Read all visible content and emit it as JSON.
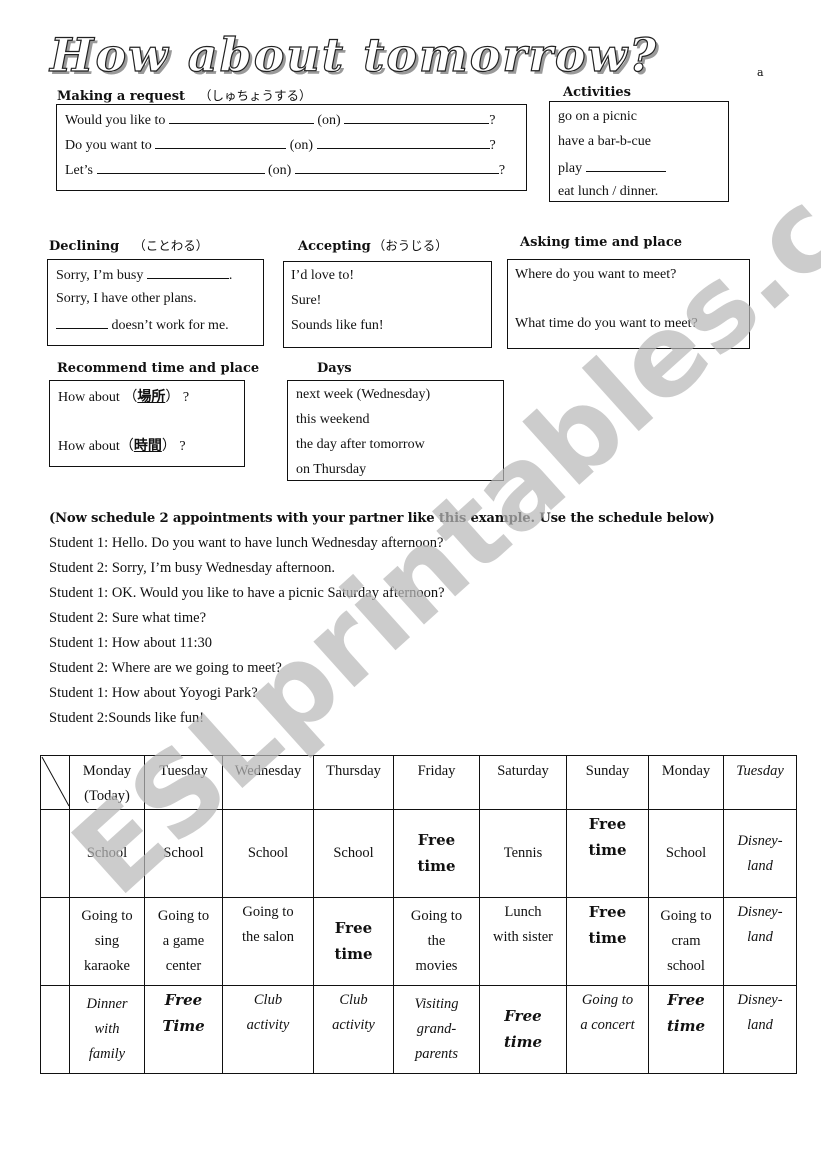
{
  "title": "How about tomorrow?",
  "title_mark": "a",
  "watermark": "ESLprintables.com",
  "sections": {
    "making_request": {
      "heading": "Making a request",
      "heading_jp": "（しゅちょうする）",
      "lines": [
        {
          "start": "Would you like to",
          "mid": "(on)",
          "end": "?"
        },
        {
          "start": "Do you want to",
          "mid": "(on)",
          "end": "?"
        },
        {
          "start": "Let’s",
          "mid": "(on)",
          "end": "?"
        }
      ]
    },
    "activities": {
      "heading": "Activities",
      "items": [
        "go on a picnic",
        "have a bar-b-cue",
        "play",
        "eat lunch / dinner."
      ]
    },
    "declining": {
      "heading": "Declining",
      "heading_jp": "（ことわる）",
      "items": [
        {
          "before": "Sorry, I’m busy",
          "after": "."
        },
        {
          "text": "Sorry, I have other plans."
        },
        {
          "before": "",
          "after": "doesn’t work for me."
        }
      ]
    },
    "accepting": {
      "heading": "Accepting",
      "heading_jp": "（おうじる）",
      "items": [
        "I’d love to!",
        "Sure!",
        "Sounds like fun!"
      ]
    },
    "asking": {
      "heading": "Asking time and place",
      "items": [
        "Where do you want to meet?",
        "What time do you want to meet?"
      ]
    },
    "recommend": {
      "heading": "Recommend time and place",
      "items": [
        {
          "text": "How about",
          "jp": "場所",
          "end": "?"
        },
        {
          "text": "How about",
          "jp": "時間",
          "end": "?"
        }
      ]
    },
    "days": {
      "heading": "Days",
      "items": [
        "next week (Wednesday)",
        "this weekend",
        "the day after tomorrow",
        "on Thursday"
      ]
    }
  },
  "instructions": "(Now schedule 2 appointments with your partner like this example. Use the schedule below)",
  "dialog": [
    "Student 1: Hello.    Do you want to have lunch Wednesday afternoon?",
    "Student 2: Sorry, I’m busy Wednesday afternoon.",
    "Student 1: OK.    Would you like to have a picnic Saturday afternoon?",
    "Student 2: Sure what time?",
    "Student 1: How about 11:30",
    "Student 2: Where are we going to meet?",
    "Student 1: How about Yoyogi Park?",
    "Student 2:Sounds like fun!"
  ],
  "schedule": {
    "days": [
      {
        "label": "Monday\n(Today)",
        "style": "normal"
      },
      {
        "label": "Tuesday",
        "style": "normal"
      },
      {
        "label": "Wednesday",
        "style": "normal"
      },
      {
        "label": "Thursday",
        "style": "normal"
      },
      {
        "label": "Friday",
        "style": "normal"
      },
      {
        "label": "Saturday",
        "style": "normal"
      },
      {
        "label": "Sunday",
        "style": "normal"
      },
      {
        "label": "Monday",
        "style": "normal"
      },
      {
        "label": "Tuesday",
        "style": "italic"
      }
    ],
    "rows": [
      [
        {
          "text": "School",
          "style": "normal"
        },
        {
          "text": "School",
          "style": "normal"
        },
        {
          "text": "School",
          "style": "normal"
        },
        {
          "text": "School",
          "style": "normal"
        },
        {
          "text": "Free\ntime",
          "style": "free"
        },
        {
          "text": "Tennis",
          "style": "normal"
        },
        {
          "text": "Free\ntime",
          "style": "free-top"
        },
        {
          "text": "School",
          "style": "normal"
        },
        {
          "text": "Disney-\nland",
          "style": "italic"
        }
      ],
      [
        {
          "text": "Going to\nsing\nkaraoke",
          "style": "normal"
        },
        {
          "text": "Going to\na game\ncenter",
          "style": "normal"
        },
        {
          "text": "Going to\nthe salon",
          "style": "normal-top"
        },
        {
          "text": "Free\ntime",
          "style": "free"
        },
        {
          "text": "Going to\nthe\nmovies",
          "style": "normal"
        },
        {
          "text": "Lunch\nwith sister",
          "style": "normal-top"
        },
        {
          "text": "Free\ntime",
          "style": "free-top"
        },
        {
          "text": "Going to\ncram\nschool",
          "style": "normal"
        },
        {
          "text": "Disney-\nland",
          "style": "italic-top"
        }
      ],
      [
        {
          "text": "Dinner\nwith\nfamily",
          "style": "italic"
        },
        {
          "text": "Free\nTime",
          "style": "italic-free-top"
        },
        {
          "text": "Club\nactivity",
          "style": "italic-top"
        },
        {
          "text": "Club\nactivity",
          "style": "italic-top"
        },
        {
          "text": "Visiting\ngrand-\nparents",
          "style": "italic"
        },
        {
          "text": "Free\ntime",
          "style": "italic-free"
        },
        {
          "text": "Going to\na concert",
          "style": "italic-top"
        },
        {
          "text": "Free\ntime",
          "style": "italic-free-top"
        },
        {
          "text": "Disney-\nland",
          "style": "italic-top"
        }
      ]
    ]
  }
}
